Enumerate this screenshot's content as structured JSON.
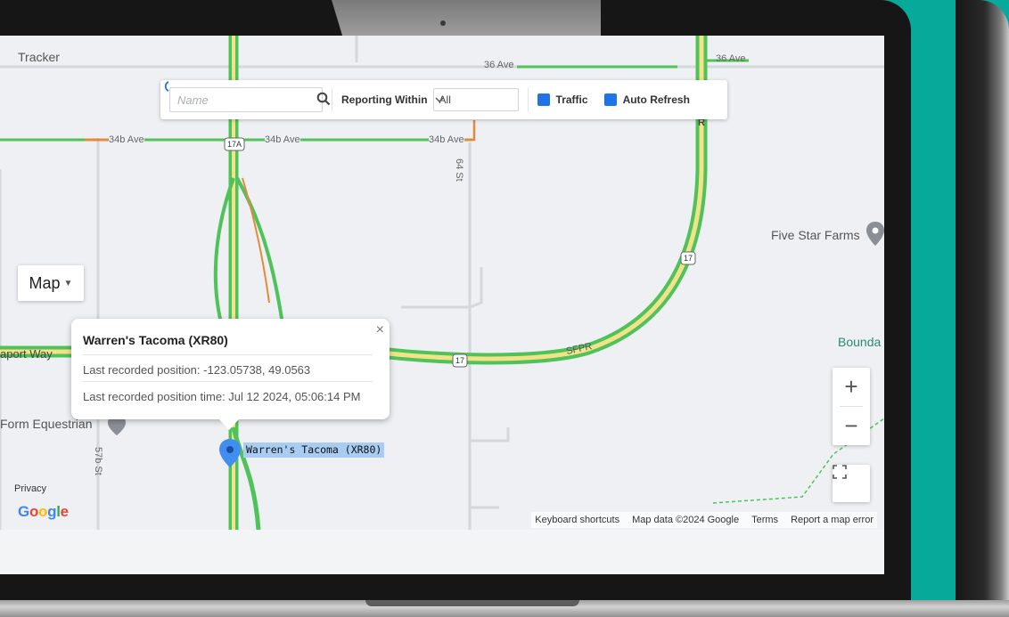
{
  "app": {
    "title": "Tracker"
  },
  "toolbar": {
    "search_placeholder": "Name",
    "reporting_label": "Reporting Within",
    "reporting_value": "All",
    "traffic_label": "Traffic",
    "auto_refresh_label": "Auto Refresh",
    "traffic_checked": true,
    "auto_refresh_checked": true
  },
  "map_type": {
    "label": "Map"
  },
  "info_window": {
    "title": "Warren's Tacoma (XR80)",
    "position_line": "Last recorded position: -123.05738, 49.0563",
    "time_line": "Last recorded position time: Jul 12 2024, 05:06:14 PM",
    "close_symbol": "×"
  },
  "marker": {
    "label": "Warren's Tacoma (XR80)"
  },
  "map_labels": {
    "ave_36_a": "36 Ave",
    "ave_36_b": "36 Ave",
    "ave_34b_a": "34b Ave",
    "ave_34b_b": "34b Ave",
    "ave_34b_c": "34b Ave",
    "st_64": "64 St",
    "st_57b": "57b St",
    "hwy_17a": "17A",
    "hwy_17_a": "17",
    "hwy_17_b": "17",
    "sfpr": "SFPR",
    "port_way": "aport Way",
    "five_star_farms": "Five Star Farms",
    "form_equestrian": "Form Equestrian",
    "bounda": "Bounda",
    "r_label": "R"
  },
  "map_controls": {
    "zoom_in": "+",
    "zoom_out": "−"
  },
  "footer": {
    "privacy": "Privacy",
    "google": "Google",
    "keyboard_shortcuts": "Keyboard shortcuts",
    "map_data": "Map data ©2024 Google",
    "terms": "Terms",
    "report": "Report a map error"
  },
  "colors": {
    "accent": "#1e74e4",
    "road_green": "#4fc25a",
    "road_yellow": "#f2e38a",
    "road_orange": "#e58a3a",
    "marker_blue": "#3f8ef0",
    "background_teal": "#06a99a"
  }
}
